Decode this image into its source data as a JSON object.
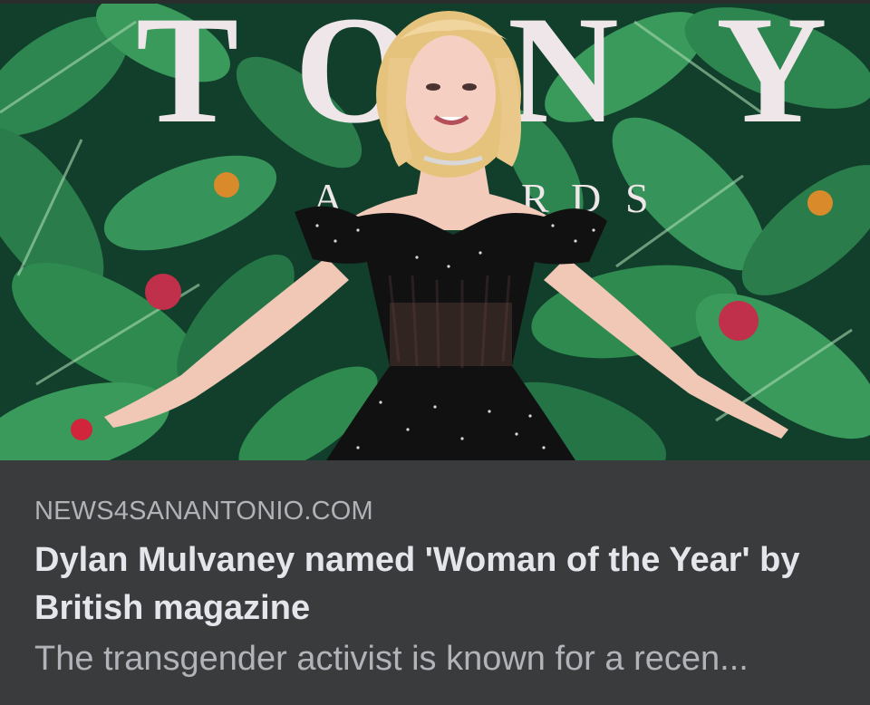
{
  "link_preview": {
    "backdrop_lettering": [
      "T",
      "O",
      "N",
      "Y",
      "A",
      "R",
      "D",
      "S"
    ],
    "domain": "NEWS4SANANTONIO.COM",
    "headline": "Dylan Mulvaney named 'Woman of the Year' by British magazine",
    "snippet": "The transgender activist is known for a recen..."
  },
  "colors": {
    "card_background": "#3a3b3c",
    "domain_text": "#b0b3b8",
    "headline_text": "#e4e6eb",
    "snippet_text": "#b0b3b8",
    "leaf_green": "#2f8a4f",
    "dark_green": "#0f3a27",
    "dress": "#111111"
  }
}
